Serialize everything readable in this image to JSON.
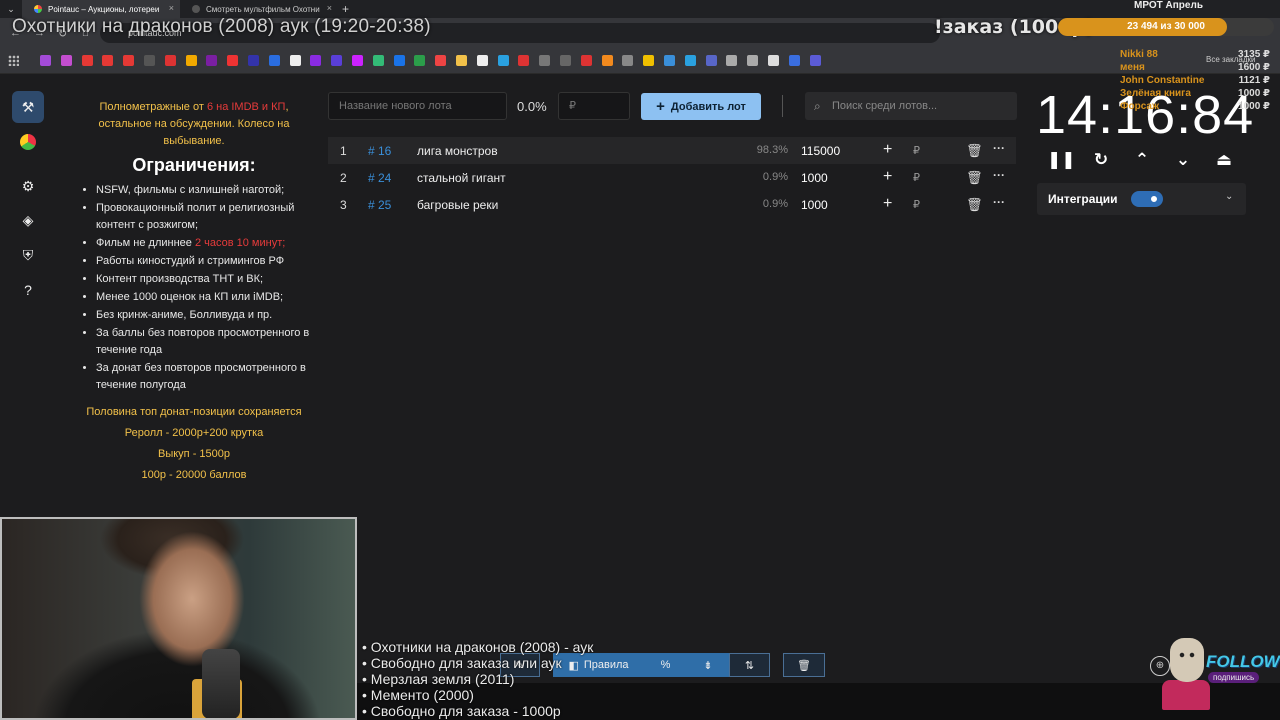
{
  "browser": {
    "tabs": [
      {
        "label": "Pointauc – Аукционы, лотереи",
        "active": true
      },
      {
        "label": "Смотреть мультфильм Охотни",
        "active": false
      }
    ],
    "url": "pointauc.com"
  },
  "stream_overlay": {
    "title": "Охотники на драконов (2008) аук (19:20-20:38)",
    "order_label": "!заказ (1000р)",
    "goal_title": "МРОТ Апрель",
    "goal_text": "23 494  из 30 000",
    "goal_fraction": 0.783,
    "donors": [
      {
        "name": "Nikki 88",
        "amount": "3135 ₽"
      },
      {
        "name": "меня",
        "amount": "1600 ₽"
      },
      {
        "name": "John Constantine",
        "amount": "1121 ₽"
      },
      {
        "name": "Зелёная книга",
        "amount": "1000 ₽"
      },
      {
        "name": "Форсаж",
        "amount": "1000 ₽"
      }
    ],
    "all_bookmarks": "Все закладки",
    "queue": [
      "• Охотники на драконов (2008) - аук",
      "• Свободно для заказа или аук",
      "• Мерзлая земля (2011)",
      "• Мементо (2000)",
      "• Свободно для заказа - 1000р"
    ],
    "follow_text": "FOLLOW",
    "follow_sub": "подпишись"
  },
  "rules": {
    "intro_a": "Полнометражные от ",
    "intro_red": "6 на IMDB и КП",
    "intro_b": ", остальное на обсуждении. Колесо на выбывание.",
    "heading": "Ограничения:",
    "items": [
      "NSFW, фильмы с излишней наготой;",
      "Провокационный полит и религиозный контент с розжигом;",
      "Фильм не длиннее ",
      "Работы киностудий и стримингов РФ",
      "Контент производства ТНТ и ВК;",
      "Менее 1000 оценок на КП или iMDB;",
      "Без кринж-аниме, Болливуда и пр.",
      "За баллы без повторов просмотренного в течение года",
      "За донат без повторов просмотренного в течение полугода"
    ],
    "duration_red": "2 часов 10 минут;",
    "notes": [
      "Половина топ донат-позиции сохраняется",
      "Реролл - 2000р+200 крутка",
      "Выкуп - 1500р",
      "100р - 20000 баллов"
    ]
  },
  "lot_form": {
    "name_placeholder": "Название нового лота",
    "percent": "0.0%",
    "amount_placeholder": "₽",
    "add_label": "Добавить лот",
    "search_placeholder": "Поиск среди лотов..."
  },
  "lots": [
    {
      "idx": "1",
      "id": "# 16",
      "name": "лига монстров",
      "pct": "98.3%",
      "amount": "115000"
    },
    {
      "idx": "2",
      "id": "# 24",
      "name": "стальной гигант",
      "pct": "0.9%",
      "amount": "1000"
    },
    {
      "idx": "3",
      "id": "# 25",
      "name": "багровые реки",
      "pct": "0.9%",
      "amount": "1000"
    }
  ],
  "timer": {
    "display": "14:16:84"
  },
  "integrations": {
    "label": "Интеграции",
    "enabled": true
  },
  "toolbar": {
    "rules_label": "Правила",
    "percent_icon": "%"
  },
  "colors": {
    "accent": "#8dc1f2",
    "lot_id": "#3a8fd9",
    "gold": "#f2c14a",
    "red": "#e63b3b",
    "goal": "#d9931c"
  }
}
